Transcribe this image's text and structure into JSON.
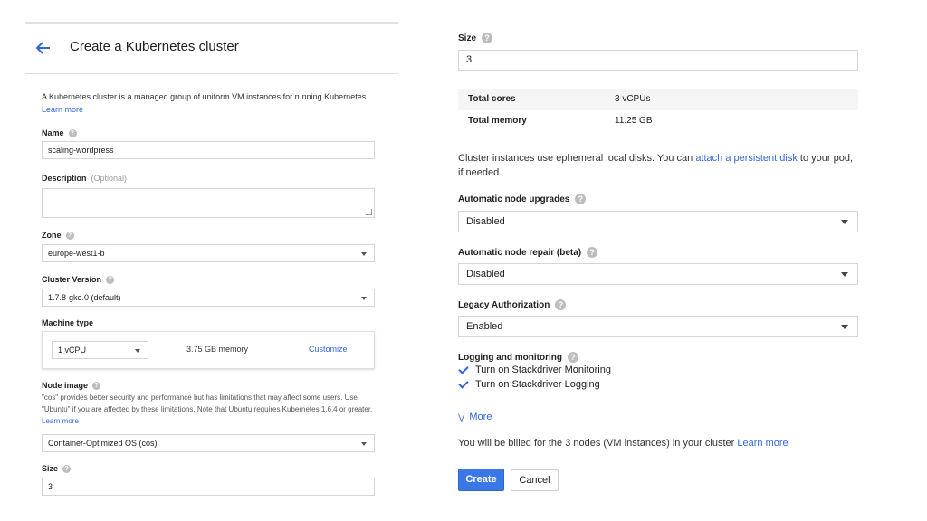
{
  "header": {
    "title": "Create a Kubernetes cluster"
  },
  "intro": {
    "text": "A Kubernetes cluster is a managed group of uniform VM instances for running Kubernetes.",
    "learn_more": "Learn more"
  },
  "left": {
    "name": {
      "label": "Name",
      "value": "scaling-wordpress"
    },
    "description": {
      "label": "Description",
      "optional": "(Optional)",
      "value": ""
    },
    "zone": {
      "label": "Zone",
      "value": "europe-west1-b"
    },
    "cluster_version": {
      "label": "Cluster Version",
      "value": "1.7.8-gke.0 (default)"
    },
    "machine_type": {
      "label": "Machine type",
      "vcpu": "1 vCPU",
      "memory": "3.75 GB memory",
      "customize": "Customize"
    },
    "node_image": {
      "label": "Node image",
      "description": "\"cos\" provides better security and performance but has limitations that may affect some users. Use \"Ubuntu\" if you are affected by these limitations. Note that Ubuntu requires Kubernetes 1.6.4 or greater.",
      "learn_more": "Learn more",
      "value": "Container-Optimized OS (cos)"
    },
    "size": {
      "label": "Size",
      "value": "3"
    }
  },
  "right": {
    "size": {
      "label": "Size",
      "value": "3"
    },
    "totals": [
      {
        "key": "Total cores",
        "value": "3 vCPUs"
      },
      {
        "key": "Total memory",
        "value": "11.25 GB"
      }
    ],
    "disk_info": {
      "text": "Cluster instances use ephemeral local disks. You can",
      "link": "attach a persistent disk",
      "after": "to your pod, if needed."
    },
    "auto_upgrades": {
      "label": "Automatic node upgrades",
      "value": "Disabled"
    },
    "auto_repair": {
      "label": "Automatic node repair (beta)",
      "value": "Disabled"
    },
    "legacy_auth": {
      "label": "Legacy Authorization",
      "value": "Enabled"
    },
    "logging": {
      "label": "Logging and monitoring",
      "items": [
        {
          "label": "Turn on Stackdriver Monitoring",
          "checked": true
        },
        {
          "label": "Turn on Stackdriver Logging",
          "checked": true
        }
      ]
    },
    "more": "More",
    "billing": {
      "text": "You will be billed for the 3 nodes (VM instances) in your cluster",
      "learn_more": "Learn more"
    },
    "buttons": {
      "create": "Create",
      "cancel": "Cancel"
    }
  },
  "colors": {
    "accent": "#3367d6",
    "primary_button": "#3b78e7"
  },
  "icons": {
    "back": "arrow-left-icon",
    "help": "help-circle-icon",
    "check": "checkmark-icon",
    "dropdown": "triangle-down-icon",
    "more": "double-chevron-down-icon"
  }
}
